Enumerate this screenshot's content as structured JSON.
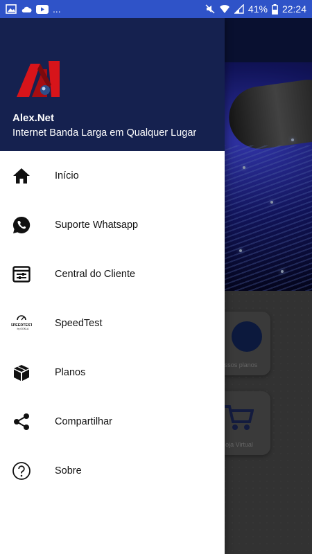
{
  "status_bar": {
    "battery": "41%",
    "time": "22:24",
    "more": "..."
  },
  "drawer": {
    "brand": "Alex.Net",
    "tagline": "Internet Banda Larga em Qualquer Lugar",
    "items": [
      {
        "label": "Início",
        "icon": "home-icon"
      },
      {
        "label": "Suporte Whatsapp",
        "icon": "whatsapp-icon"
      },
      {
        "label": "Central do Cliente",
        "icon": "client-panel-icon"
      },
      {
        "label": "SpeedTest",
        "icon": "speedtest-icon"
      },
      {
        "label": "Planos",
        "icon": "box-icon"
      },
      {
        "label": "Compartilhar",
        "icon": "share-icon"
      },
      {
        "label": "Sobre",
        "icon": "help-icon"
      }
    ]
  },
  "background": {
    "card_plans": "ossos planos",
    "card_store": "oja Virtual"
  },
  "colors": {
    "status_bar": "#2f53c8",
    "drawer_header": "#15214f",
    "brand_red": "#d7141a"
  }
}
